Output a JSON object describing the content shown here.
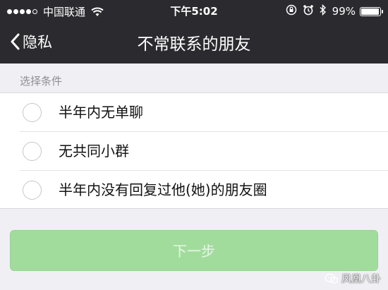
{
  "status_bar": {
    "carrier": "中国联通",
    "time": "下午5:02",
    "battery": "99%",
    "signal_bars_filled": 4,
    "signal_bars_total": 5,
    "battery_level": 0.99
  },
  "nav": {
    "back_label": "隐私",
    "title": "不常联系的朋友"
  },
  "section": {
    "header": "选择条件"
  },
  "options": [
    {
      "label": "半年内无单聊",
      "selected": false
    },
    {
      "label": "无共同小群",
      "selected": false
    },
    {
      "label": "半年内没有回复过他(她)的朋友圈",
      "selected": false
    }
  ],
  "next_button": {
    "label": "下一步",
    "enabled": false
  },
  "watermark": {
    "text": "凤凰八卦"
  },
  "colors": {
    "navbar_bg": "#2b2a2f",
    "page_bg": "#efeff4",
    "button_bg_disabled": "#a2dc9d"
  }
}
